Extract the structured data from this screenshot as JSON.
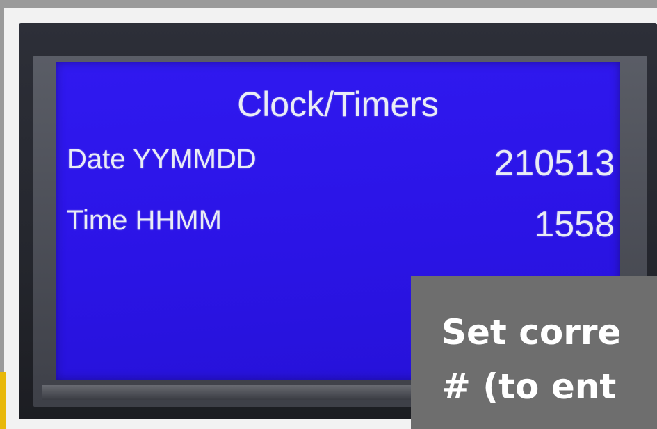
{
  "screen": {
    "title": "Clock/Timers",
    "rows": [
      {
        "label": "Date YYMMDD",
        "value": "210513"
      },
      {
        "label": "Time HHMM",
        "value": "1558"
      }
    ]
  },
  "caption": {
    "line1": "Set corre",
    "line2": "# (to ent"
  },
  "colors": {
    "lcd_background": "#2b14e6",
    "lcd_text": "#e9ecf5",
    "caption_background": "#6e6e6e",
    "accent_yellow": "#e8b80a"
  }
}
